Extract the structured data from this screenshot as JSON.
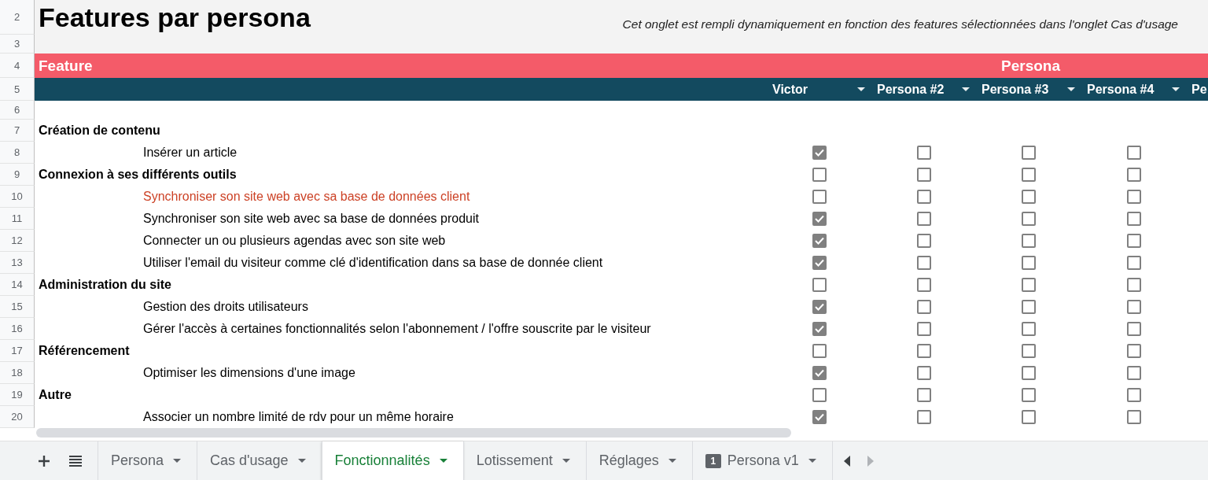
{
  "sheet": {
    "title": "Features par persona",
    "description": "Cet onglet est rempli dynamiquement en fonction des features sélectionnées dans l'onglet Cas d'usage",
    "row_numbers": [
      "2",
      "3",
      "4",
      "5",
      "6"
    ],
    "feature_header": "Feature",
    "persona_header": "Persona",
    "personas": [
      {
        "name": "Victor"
      },
      {
        "name": "Persona #2"
      },
      {
        "name": "Persona #3"
      },
      {
        "name": "Persona #4"
      },
      {
        "name": "Pe"
      }
    ],
    "rows": [
      {
        "number": "7",
        "kind": "category",
        "label": "Création de contenu"
      },
      {
        "number": "8",
        "kind": "feature",
        "label": "Insérer un article",
        "flagged": false,
        "checks": [
          true,
          false,
          false,
          false
        ]
      },
      {
        "number": "9",
        "kind": "category",
        "label": "Connexion à ses différents outils",
        "checks": [
          false,
          false,
          false,
          false
        ]
      },
      {
        "number": "10",
        "kind": "feature",
        "label": "Synchroniser son site web avec sa base de données client",
        "flagged": true,
        "checks": [
          false,
          false,
          false,
          false
        ]
      },
      {
        "number": "11",
        "kind": "feature",
        "label": "Synchroniser son site web avec sa base de données produit",
        "flagged": false,
        "checks": [
          true,
          false,
          false,
          false
        ]
      },
      {
        "number": "12",
        "kind": "feature",
        "label": "Connecter un ou plusieurs agendas avec son site web",
        "flagged": false,
        "checks": [
          true,
          false,
          false,
          false
        ]
      },
      {
        "number": "13",
        "kind": "feature",
        "label": "Utiliser l'email du visiteur comme clé d'identification dans sa base de donnée client",
        "flagged": false,
        "checks": [
          true,
          false,
          false,
          false
        ]
      },
      {
        "number": "14",
        "kind": "category",
        "label": "Administration du site",
        "checks": [
          false,
          false,
          false,
          false
        ]
      },
      {
        "number": "15",
        "kind": "feature",
        "label": "Gestion des droits utilisateurs",
        "flagged": false,
        "checks": [
          true,
          false,
          false,
          false
        ]
      },
      {
        "number": "16",
        "kind": "feature",
        "label": "Gérer l'accès à certaines fonctionnalités selon l'abonnement / l'offre souscrite par le visiteur",
        "flagged": false,
        "checks": [
          true,
          false,
          false,
          false
        ]
      },
      {
        "number": "17",
        "kind": "category",
        "label": "Référencement",
        "checks": [
          false,
          false,
          false,
          false
        ]
      },
      {
        "number": "18",
        "kind": "feature",
        "label": "Optimiser les dimensions d'une image",
        "flagged": false,
        "checks": [
          true,
          false,
          false,
          false
        ]
      },
      {
        "number": "19",
        "kind": "category",
        "label": "Autre",
        "checks": [
          false,
          false,
          false,
          false
        ]
      },
      {
        "number": "20",
        "kind": "feature",
        "label": "Associer un nombre limité de rdv pour un même horaire",
        "flagged": false,
        "checks": [
          true,
          false,
          false,
          false
        ]
      }
    ]
  },
  "sheet_tabs": [
    {
      "label": "Persona",
      "selected": false
    },
    {
      "label": "Cas d'usage",
      "selected": false
    },
    {
      "label": "Fonctionnalités",
      "selected": true
    },
    {
      "label": "Lotissement",
      "selected": false
    },
    {
      "label": "Réglages",
      "selected": false
    },
    {
      "label": "Persona v1",
      "selected": false,
      "badge": "1"
    }
  ]
}
